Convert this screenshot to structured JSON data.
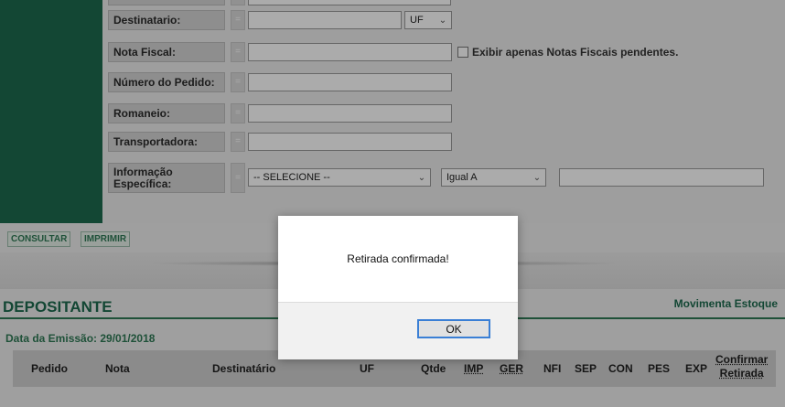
{
  "form": {
    "fields": {
      "destinatario": "Destinatario:",
      "nota_fiscal": "Nota Fiscal:",
      "numero_pedido": "Número do Pedido:",
      "romaneio": "Romaneio:",
      "transportadora": "Transportadora:",
      "informacao_especifica_1": "Informação",
      "informacao_especifica_2": "Específica:"
    },
    "eq_symbol": "=",
    "uf_select": "UF",
    "checkbox_label": "Exibir apenas Notas Fiscais pendentes.",
    "selecione": "-- SELECIONE --",
    "igual_a": "Igual A"
  },
  "buttons": {
    "consultar": "CONSULTAR",
    "imprimir": "IMPRIMIR"
  },
  "section": {
    "title": "DEPOSITANTE",
    "link": "Movimenta Estoque",
    "data_emissao": "Data da Emissão: 29/01/2018"
  },
  "table": {
    "headers": {
      "pedido": "Pedido",
      "nota": "Nota",
      "destinatario": "Destinatário",
      "uf": "UF",
      "qtde": "Qtde",
      "imp": "IMP",
      "ger": "GER",
      "nfi": "NFI",
      "sep": "SEP",
      "con": "CON",
      "pes": "PES",
      "exp": "EXP",
      "confirmar_1": "Confirmar",
      "confirmar_2": "Retirada"
    }
  },
  "dialog": {
    "message": "Retirada confirmada!",
    "ok": "OK"
  },
  "colors": {
    "brand_green": "#1d6a4e",
    "focus_blue": "#3a7fd5"
  }
}
